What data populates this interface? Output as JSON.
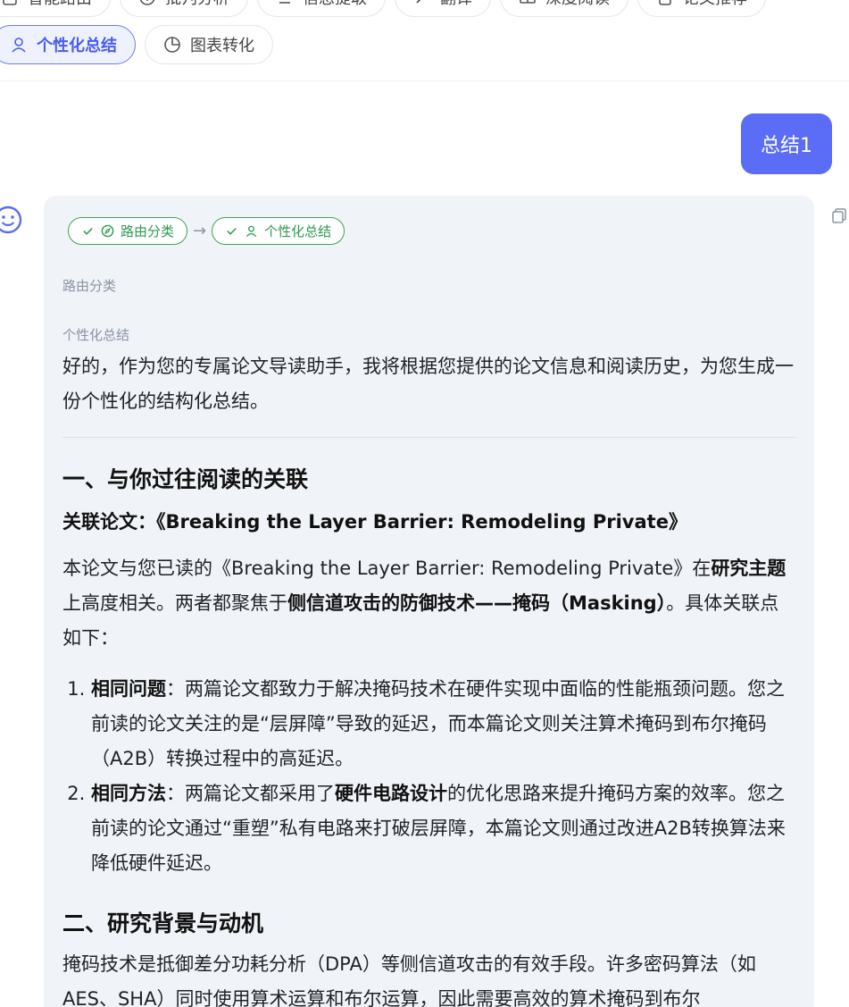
{
  "toolbar": {
    "row1": [
      {
        "label": "智能路由",
        "icon": "document-icon"
      },
      {
        "label": "批判分析",
        "icon": "info-icon"
      },
      {
        "label": "信息提取",
        "icon": "extract-icon"
      },
      {
        "label": "翻译",
        "icon": "pen-icon"
      },
      {
        "label": "深度阅读",
        "icon": "book-icon"
      },
      {
        "label": "论文推荐",
        "icon": "file-icon"
      }
    ],
    "row2": [
      {
        "label": "个性化总结",
        "icon": "user-icon",
        "active": true
      },
      {
        "label": "图表转化",
        "icon": "pie-icon"
      }
    ]
  },
  "user_message": "总结1",
  "assistant": {
    "steps": [
      {
        "label": "路由分类",
        "icon": "compass-icon",
        "status": "done"
      },
      {
        "label": "个性化总结",
        "icon": "user-icon",
        "status": "done"
      }
    ],
    "stage1_label": "路由分类",
    "stage2_label": "个性化总结",
    "intro": "好的，作为您的专属论文导读助手，我将根据您提供的论文信息和阅读历史，为您生成一份个性化的结构化总结。",
    "section1": {
      "heading": "一、与你过往阅读的关联",
      "related_label": "关联论文：",
      "related_title": "《Breaking the Layer Barrier: Remodeling Private》",
      "p_parts": [
        "本论文与您已读的《Breaking the Layer Barrier: Remodeling Private》在",
        "研究主题",
        "上高度相关。两者都聚焦于",
        "侧信道攻击的防御技术——掩码（Masking）",
        "。具体关联点如下："
      ],
      "items": [
        {
          "bold": "相同问题",
          "text": "：两篇论文都致力于解决掩码技术在硬件实现中面临的性能瓶颈问题。您之前读的论文关注的是“层屏障”导致的延迟，而本篇论文则关注算术掩码到布尔掩码（A2B）转换过程中的高延迟。"
        },
        {
          "bold": "相同方法",
          "text_a": "：两篇论文都采用了",
          "bold2": "硬件电路设计",
          "text_b": "的优化思路来提升掩码方案的效率。您之前读的论文通过“重塑”私有电路来打破层屏障，本篇论文则通过改进A2B转换算法来降低硬件延迟。"
        }
      ]
    },
    "section2": {
      "heading": "二、研究背景与动机",
      "para": "掩码技术是抵御差分功耗分析（DPA）等侧信道攻击的有效手段。许多密码算法（如AES、SHA）同时使用算术运算和布尔运算，因此需要高效的算术掩码到布尔"
    }
  }
}
